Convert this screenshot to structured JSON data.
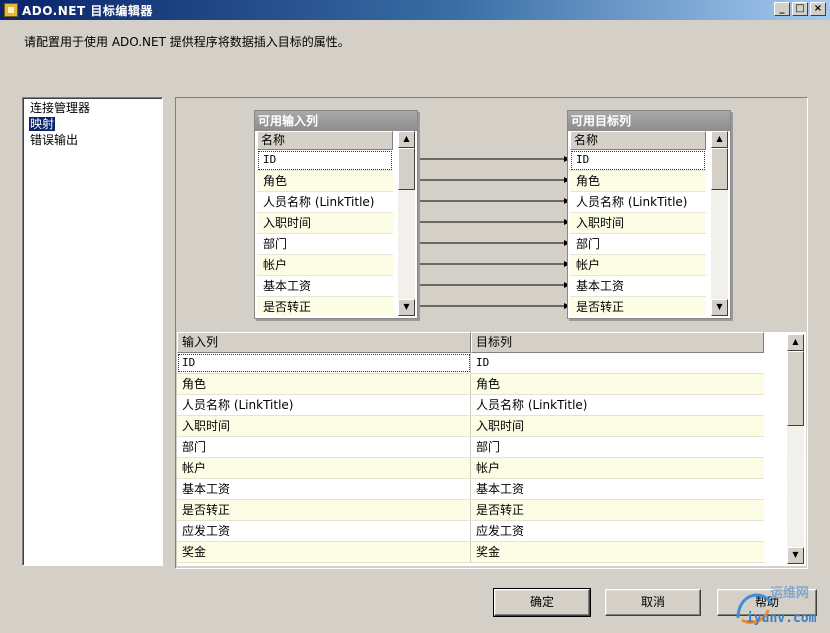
{
  "window": {
    "title": "ADO.NET 目标编辑器",
    "controls": [
      "_",
      "□",
      "×"
    ]
  },
  "description": "请配置用于使用 ADO.NET 提供程序将数据插入目标的属性。",
  "nav": {
    "items": [
      {
        "label": "连接管理器",
        "selected": false
      },
      {
        "label": "映射",
        "selected": true
      },
      {
        "label": "错误输出",
        "selected": false
      }
    ]
  },
  "diagram": {
    "input_box": {
      "title": "可用输入列",
      "header": "名称",
      "rows": [
        "ID",
        "角色",
        "人员名称 (LinkTitle)",
        "入职时间",
        "部门",
        "帐户",
        "基本工资",
        "是否转正"
      ]
    },
    "target_box": {
      "title": "可用目标列",
      "header": "名称",
      "rows": [
        "ID",
        "角色",
        "人员名称 (LinkTitle)",
        "入职时间",
        "部门",
        "帐户",
        "基本工资",
        "是否转正"
      ]
    }
  },
  "grid": {
    "headers": [
      "输入列",
      "目标列"
    ],
    "rows": [
      [
        "ID",
        "ID"
      ],
      [
        "角色",
        "角色"
      ],
      [
        "人员名称 (LinkTitle)",
        "人员名称 (LinkTitle)"
      ],
      [
        "入职时间",
        "入职时间"
      ],
      [
        "部门",
        "部门"
      ],
      [
        "帐户",
        "帐户"
      ],
      [
        "基本工资",
        "基本工资"
      ],
      [
        "是否转正",
        "是否转正"
      ],
      [
        "应发工资",
        "应发工资"
      ],
      [
        "奖金",
        "奖金"
      ]
    ]
  },
  "buttons": {
    "ok": "确定",
    "cancel": "取消",
    "help": "帮助"
  },
  "watermark": {
    "line1": "运维网",
    "line2": "iyunv.com"
  },
  "colors": {
    "title_gradient_start": "#0a246a",
    "selection": "#0a246a",
    "row_alt": "#fdfde6"
  }
}
